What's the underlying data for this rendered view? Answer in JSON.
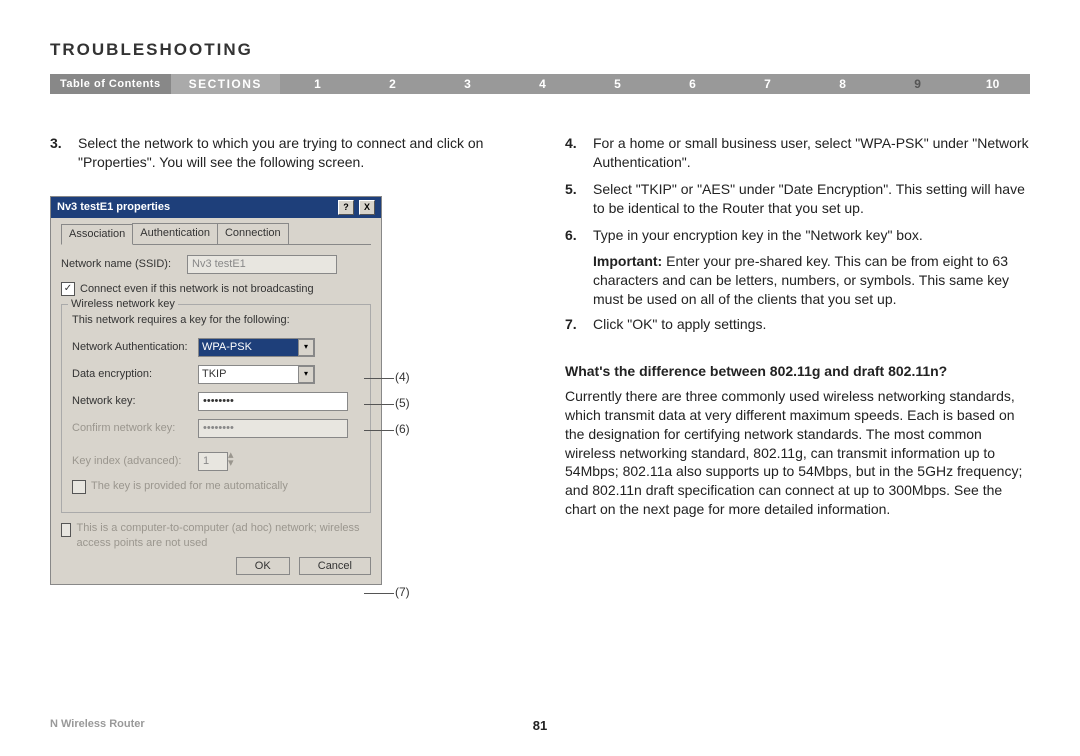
{
  "header": {
    "title": "TROUBLESHOOTING"
  },
  "nav": {
    "toc": "Table of Contents",
    "sections": "SECTIONS",
    "n1": "1",
    "n2": "2",
    "n3": "3",
    "n4": "4",
    "n5": "5",
    "n6": "6",
    "n7": "7",
    "n8": "8",
    "n9": "9",
    "n10": "10"
  },
  "left": {
    "s3_num": "3.",
    "s3": "Select the network to which you are trying to connect and click on \"Properties\". You will see the following screen."
  },
  "dialog": {
    "title": "Nv3 testE1 properties",
    "help": "?",
    "close": "X",
    "tab1": "Association",
    "tab2": "Authentication",
    "tab3": "Connection",
    "ssid_label": "Network name (SSID):",
    "ssid_value": "Nv3 testE1",
    "connect_chk_checked": "✓",
    "connect_chk": "Connect even if this network is not broadcasting",
    "legend": "Wireless network key",
    "keymsg": "This network requires a key for the following:",
    "auth_label": "Network Authentication:",
    "auth_value": "WPA-PSK",
    "enc_label": "Data encryption:",
    "enc_value": "TKIP",
    "key_label": "Network key:",
    "key_value": "••••••••",
    "confirm_label": "Confirm network key:",
    "confirm_value": "••••••••",
    "idx_label": "Key index (advanced):",
    "idx_value": "1",
    "auto_chk": "The key is provided for me automatically",
    "adhoc": "This is a computer-to-computer (ad hoc) network; wireless access points are not used",
    "ok": "OK",
    "cancel": "Cancel",
    "c4": "(4)",
    "c5": "(5)",
    "c6": "(6)",
    "c7": "(7)"
  },
  "right": {
    "s4_num": "4.",
    "s4": "For a home or small business user, select \"WPA-PSK\" under \"Network Authentication\".",
    "s5_num": "5.",
    "s5": "Select \"TKIP\" or \"AES\" under \"Date Encryption\". This setting will have to be identical to the Router that you set up.",
    "s6_num": "6.",
    "s6": "Type in your encryption key in the \"Network key\" box.",
    "imp_label": "Important:",
    "imp": " Enter your pre-shared key. This can be from eight to 63 characters and can be letters, numbers, or symbols. This same key must be used on all of the clients that you set up.",
    "s7_num": "7.",
    "s7": "Click \"OK\" to apply settings.",
    "q": "What's the difference between 802.11g and draft 802.11n?",
    "answer": "Currently there are three commonly used wireless networking standards, which transmit data at very different maximum speeds. Each is based on the designation for certifying network standards. The most common wireless networking standard, 802.11g, can transmit information up to 54Mbps; 802.11a also supports up to 54Mbps, but in the 5GHz frequency; and 802.11n draft specification can connect at up to 300Mbps. See the chart on the next page for more detailed information."
  },
  "footer": {
    "product": "N Wireless Router",
    "page": "81"
  }
}
